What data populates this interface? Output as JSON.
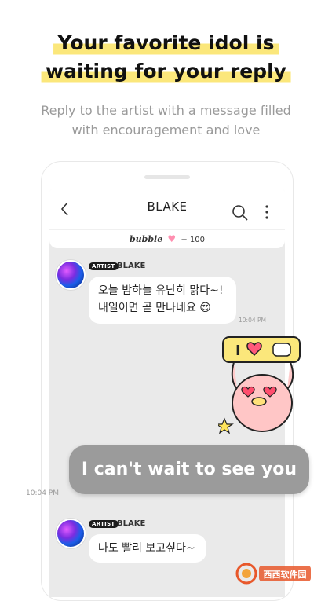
{
  "headline": {
    "line1": "Your favorite idol is",
    "line2": "waiting for your reply"
  },
  "subheadline": {
    "line1": "Reply to the artist with a message filled",
    "line2": "with encouragement and love"
  },
  "chat": {
    "title": "BLAKE",
    "bubble_bar": {
      "brand": "bubble",
      "count": "+ 100"
    },
    "messages": [
      {
        "tag": "ARTIST",
        "sender": "BLAKE",
        "line1": "오늘 밤하늘 유난히 맑다~!",
        "line2": "내일이면 곧 만나네요 😍",
        "time": "10:04 PM"
      },
      {
        "tag": "ARTIST",
        "sender": "BLAKE",
        "line1": "나도 빨리 보고싶다~"
      }
    ],
    "my_message": {
      "text": "I can't wait to see you",
      "time": "10:04 PM"
    }
  },
  "colors": {
    "highlight": "#fbe77b",
    "my_bubble": "#9b9b9b",
    "chat_bg": "#eaeaea"
  },
  "icons": [
    "back-arrow-icon",
    "search-icon",
    "more-vertical-icon",
    "heart-icon",
    "sticker-icon"
  ]
}
